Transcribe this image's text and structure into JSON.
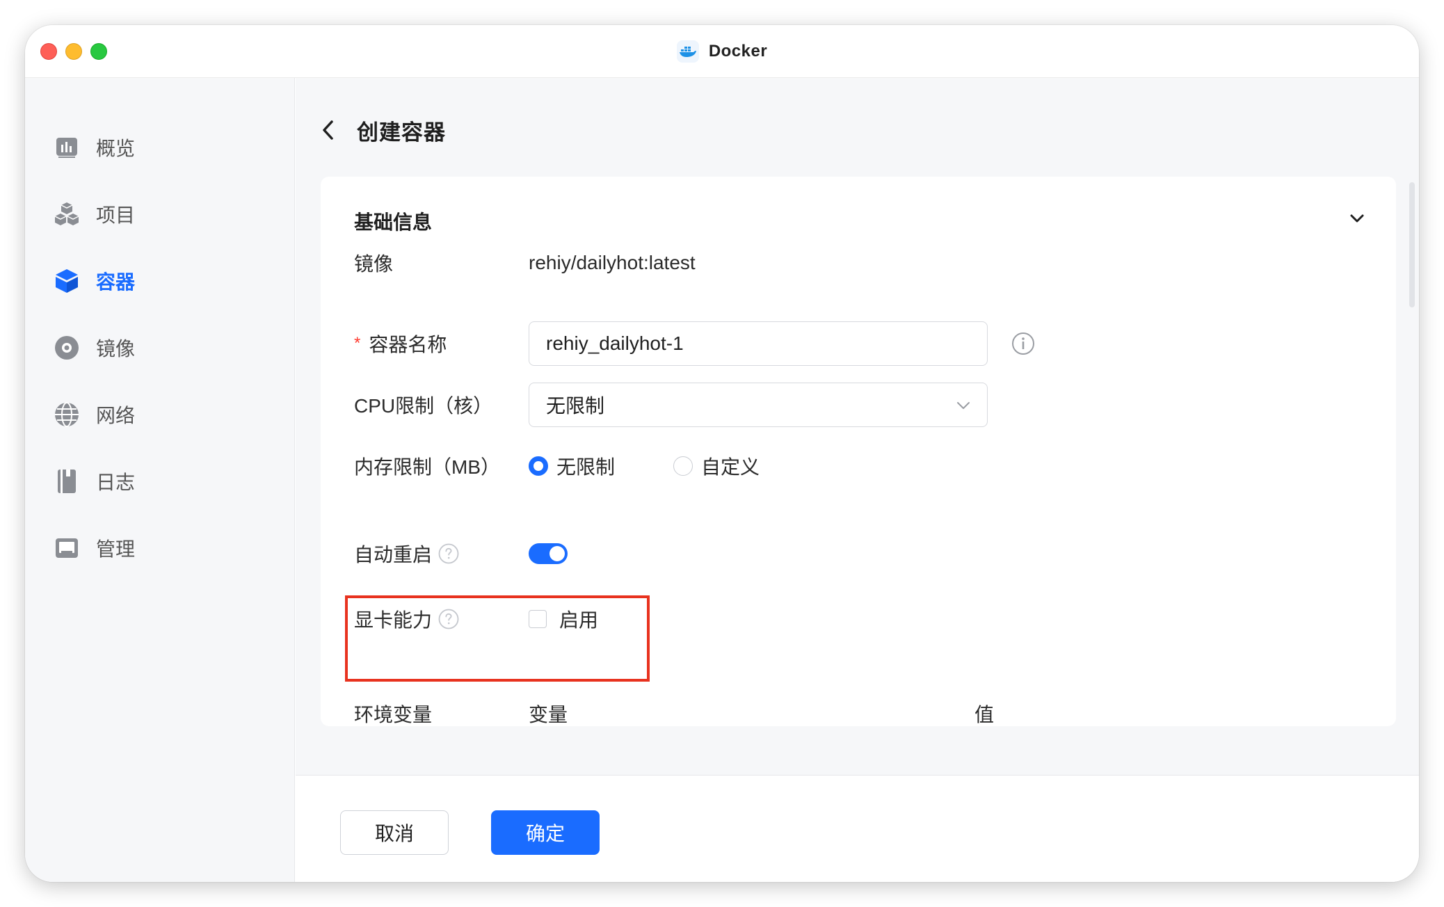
{
  "window": {
    "title": "Docker"
  },
  "sidebar": {
    "items": [
      {
        "label": "概览",
        "icon": "chart-icon",
        "active": false
      },
      {
        "label": "项目",
        "icon": "cubes-icon",
        "active": false
      },
      {
        "label": "容器",
        "icon": "container-box-icon",
        "active": true
      },
      {
        "label": "镜像",
        "icon": "disc-icon",
        "active": false
      },
      {
        "label": "网络",
        "icon": "globe-icon",
        "active": false
      },
      {
        "label": "日志",
        "icon": "notebook-icon",
        "active": false
      },
      {
        "label": "管理",
        "icon": "monitor-icon",
        "active": false
      }
    ]
  },
  "page": {
    "title": "创建容器"
  },
  "basic_info": {
    "section_title": "基础信息",
    "image": {
      "label": "镜像",
      "value": "rehiy/dailyhot:latest"
    },
    "container_name": {
      "required_mark": "*",
      "label": "容器名称",
      "value": "rehiy_dailyhot-1"
    },
    "cpu_limit": {
      "label": "CPU限制（核）",
      "value": "无限制"
    },
    "memory_limit": {
      "label": "内存限制（MB）",
      "options": [
        {
          "label": "无限制",
          "selected": true
        },
        {
          "label": "自定义",
          "selected": false
        }
      ]
    },
    "auto_restart": {
      "label": "自动重启",
      "enabled": true
    },
    "gpu": {
      "label": "显卡能力",
      "checkbox_label": "启用",
      "checked": false
    },
    "env_vars": {
      "label": "环境变量",
      "col_variable": "变量",
      "col_value": "值"
    }
  },
  "footer": {
    "cancel_label": "取消",
    "confirm_label": "确定"
  },
  "colors": {
    "accent": "#1a6cff",
    "highlight": "#e8321f"
  }
}
